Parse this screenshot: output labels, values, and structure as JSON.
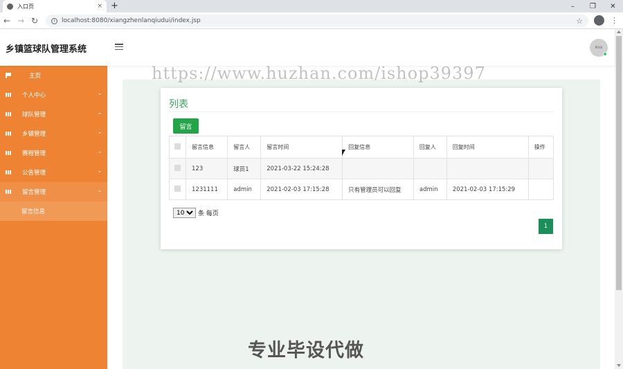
{
  "browser": {
    "tab_title": "入口页",
    "tab_close": "×",
    "new_tab": "+",
    "url": "localhost:8080/xiangzhenlanqiudui/index.jsp",
    "window_controls": [
      "–",
      "❐",
      "✕"
    ]
  },
  "header": {
    "title": "乡镇篮球队管理系统",
    "avatar_text": "ROLE"
  },
  "sidebar": {
    "items": [
      {
        "label": "主页",
        "icon": "flag-icon"
      },
      {
        "label": "个人中心",
        "icon": "grid-icon"
      },
      {
        "label": "球队管理",
        "icon": "grid-icon"
      },
      {
        "label": "乡镇管理",
        "icon": "grid-icon"
      },
      {
        "label": "赛程管理",
        "icon": "grid-icon"
      },
      {
        "label": "公告管理",
        "icon": "grid-icon"
      },
      {
        "label": "留言管理",
        "icon": "grid-icon"
      }
    ],
    "sub_item": "留言信息"
  },
  "main": {
    "card_title": "列表",
    "add_button": "留言",
    "columns": [
      "留言信息",
      "留言人",
      "留言时间",
      "回复信息",
      "回复人",
      "回复时间",
      "操作"
    ],
    "rows": [
      [
        "123",
        "球员1",
        "2021-03-22 15:24:28",
        "",
        "",
        "",
        ""
      ],
      [
        "1231111",
        "admin",
        "2021-02-03 17:15:28",
        "只有管理员可以回复",
        "admin",
        "2021-02-03 17:15:29",
        ""
      ]
    ],
    "page_size": "10",
    "page_size_suffix": "条 每页",
    "current_page": "1"
  },
  "watermarks": {
    "url": "https://www.huzhan.com/ishop39397",
    "slogan": "专业毕设代做"
  },
  "colors": {
    "sidebar": "#ee8433",
    "accent_green": "#22a447",
    "title_green": "#3aa860"
  }
}
